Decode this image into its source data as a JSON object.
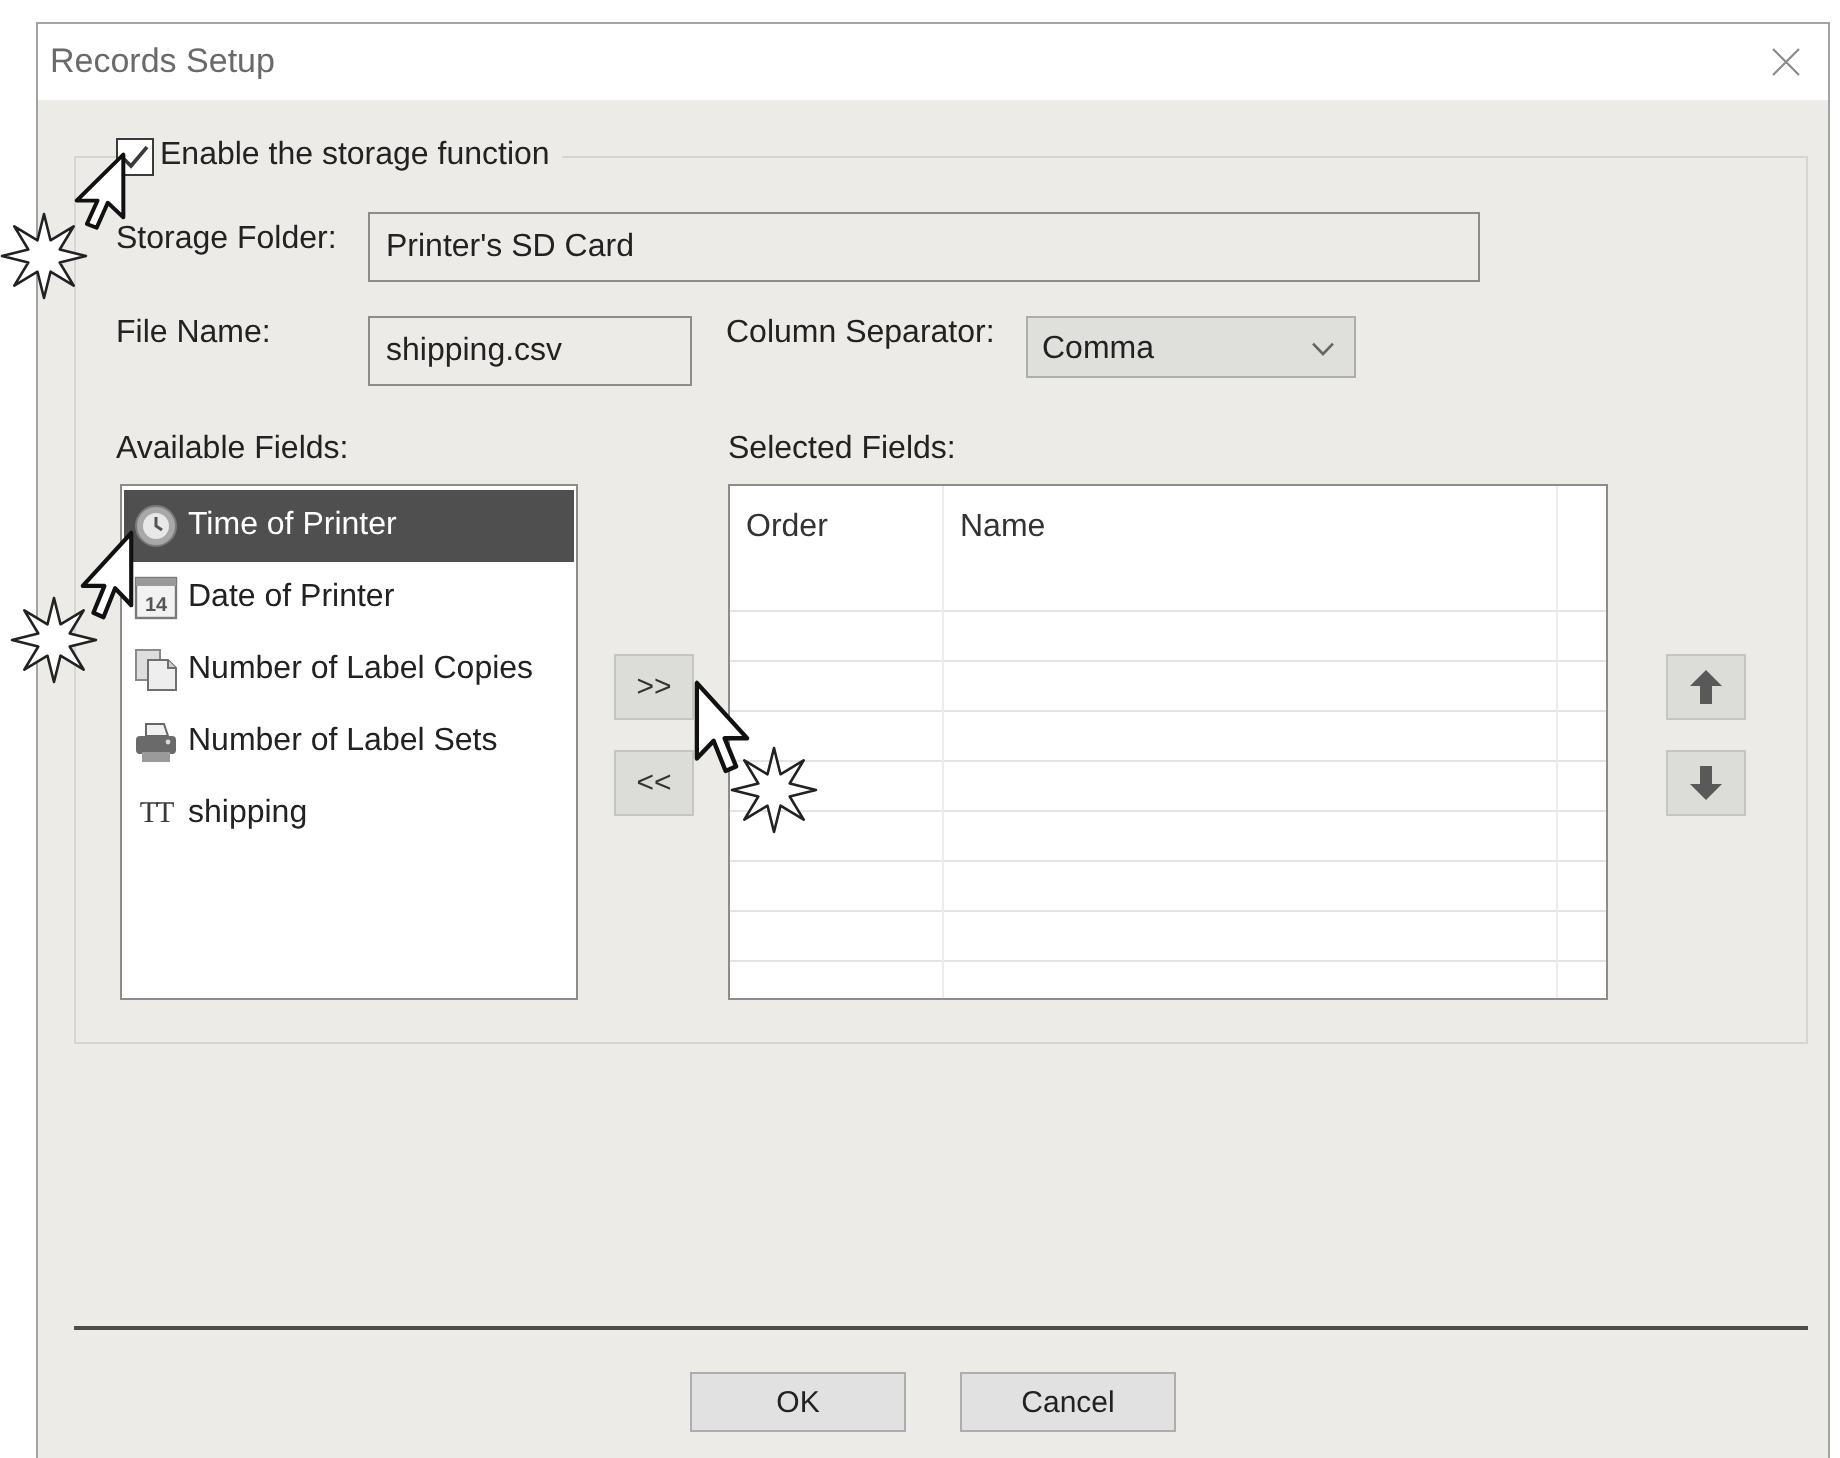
{
  "window": {
    "title": "Records Setup"
  },
  "storage": {
    "enabled": true,
    "label": "Enable the storage function"
  },
  "storage_folder": {
    "label": "Storage Folder:",
    "value": "Printer's SD Card"
  },
  "file_name": {
    "label": "File Name:",
    "value": "shipping.csv"
  },
  "column_separator": {
    "label": "Column Separator:",
    "value": "Comma"
  },
  "available_fields": {
    "label": "Available Fields:",
    "items": [
      {
        "kind": "time",
        "label": "Time of Printer",
        "selected": true
      },
      {
        "kind": "date",
        "icon_text": "14",
        "label": "Date of Printer",
        "selected": false
      },
      {
        "kind": "copies",
        "label": "Number of Label Copies",
        "selected": false
      },
      {
        "kind": "sets",
        "label": "Number of Label Sets",
        "selected": false
      },
      {
        "kind": "text",
        "icon_text": "TT",
        "label": "shipping",
        "selected": false
      }
    ]
  },
  "transfer_buttons": [
    {
      "label": ">>"
    },
    {
      "label": "<<"
    }
  ],
  "selected_fields": {
    "label": "Selected Fields:",
    "columns": [
      "Order",
      "Name"
    ]
  },
  "order_buttons": [
    {
      "kind": "up"
    },
    {
      "kind": "down"
    }
  ],
  "buttons": [
    {
      "label": "OK"
    },
    {
      "label": "Cancel"
    }
  ]
}
